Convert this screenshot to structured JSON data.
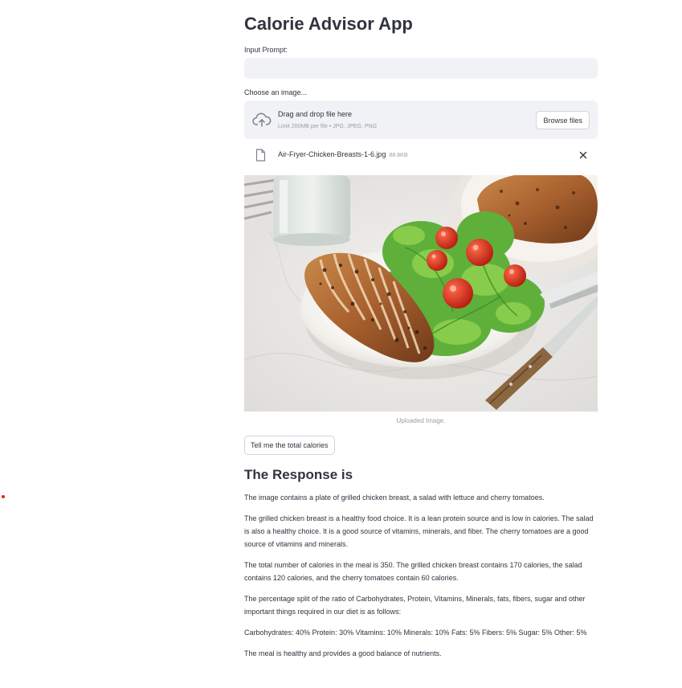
{
  "app": {
    "title": "Calorie Advisor App"
  },
  "prompt": {
    "label": "Input Prompt:",
    "value": ""
  },
  "uploader": {
    "label": "Choose an image...",
    "dropzone_title": "Drag and drop file here",
    "dropzone_limit": "Limit 200MB per file • JPG, JPEG, PNG",
    "browse_label": "Browse files",
    "upload_icon": "cloud-upload-icon",
    "file": {
      "icon": "file-icon",
      "name": "Air-Fryer-Chicken-Breasts-1-6.jpg",
      "size": "88.8KB",
      "remove_icon": "close-icon"
    }
  },
  "image": {
    "caption": "Uploaded Image."
  },
  "submit": {
    "label": "Tell me the total calories"
  },
  "response": {
    "heading": "The Response is",
    "paragraphs": [
      "The image contains a plate of grilled chicken breast, a salad with lettuce and cherry tomatoes.",
      "The grilled chicken breast is a healthy food choice. It is a lean protein source and is low in calories. The salad is also a healthy choice. It is a good source of vitamins, minerals, and fiber. The cherry tomatoes are a good source of vitamins and minerals.",
      "The total number of calories in the meal is 350. The grilled chicken breast contains 170 calories, the salad contains 120 calories, and the cherry tomatoes contain 60 calories.",
      "The percentage split of the ratio of Carbohydrates, Protein, Vitamins, Minerals, fats, fibers, sugar and other important things required in our diet is as follows:",
      "Carbohydrates: 40% Protein: 30% Vitamins: 10% Minerals: 10% Fats: 5% Fibers: 5% Sugar: 5% Other: 5%",
      "The meal is healthy and provides a good balance of nutrients."
    ]
  },
  "colors": {
    "text": "#31333f",
    "muted": "#9a9ca6",
    "input_bg": "#f0f2f6",
    "border": "#d3d4d8"
  }
}
